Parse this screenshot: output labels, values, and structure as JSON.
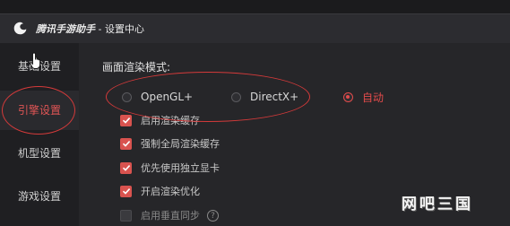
{
  "titlebar": {
    "app_name": "腾讯手游助手",
    "page_name": " - 设置中心"
  },
  "sidebar": {
    "items": [
      {
        "label": "基础设置"
      },
      {
        "label": "引擎设置"
      },
      {
        "label": "机型设置"
      },
      {
        "label": "游戏设置"
      }
    ],
    "active_index": 1
  },
  "render": {
    "title": "画面渲染模式:",
    "options": [
      {
        "label": "OpenGL+",
        "checked": false
      },
      {
        "label": "DirectX+",
        "checked": false
      },
      {
        "label": "自动",
        "checked": true
      }
    ]
  },
  "checkboxes": [
    {
      "label": "启用渲染缓存",
      "checked": true
    },
    {
      "label": "强制全局渲染缓存",
      "checked": true
    },
    {
      "label": "优先使用独立显卡",
      "checked": true
    },
    {
      "label": "开启渲染优化",
      "checked": true
    },
    {
      "label": "启用垂直同步",
      "checked": false
    }
  ],
  "help_glyph": "?",
  "watermark": "网吧三国",
  "colors": {
    "accent": "#e24b4b",
    "background": "#262629",
    "sidebar": "#1f1f22"
  },
  "icons": {
    "app_logo": "tencent-assistant-logo-icon",
    "cursor": "hand-pointer-icon",
    "check": "checkmark-icon",
    "help": "question-circle-icon"
  }
}
